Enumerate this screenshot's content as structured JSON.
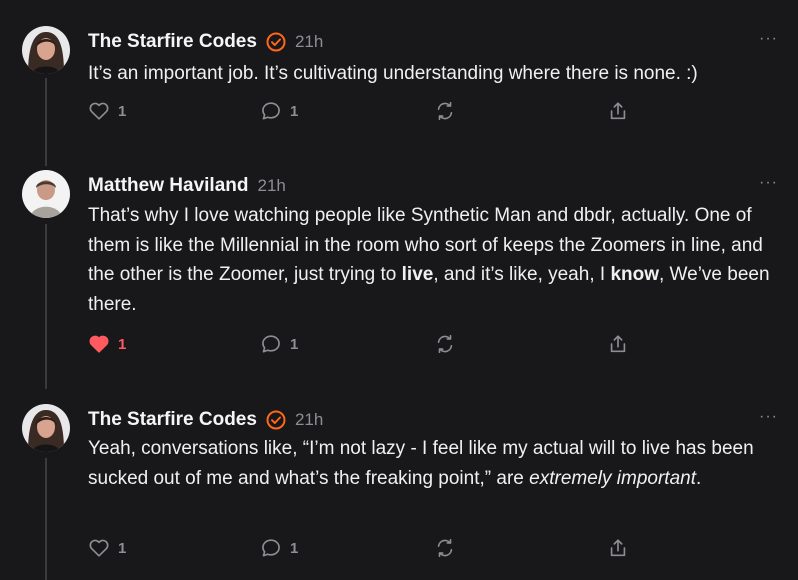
{
  "posts": [
    {
      "author": "The Starfire Codes",
      "verified": true,
      "time": "21h",
      "more_label": "···",
      "text": [
        {
          "t": "It’s an important job. It’s cultivating understanding where there is none. :)",
          "s": "plain"
        }
      ],
      "likes": "1",
      "liked": false,
      "comments": "1"
    },
    {
      "author": "Matthew Haviland",
      "verified": false,
      "time": "21h",
      "more_label": "···",
      "text": [
        {
          "t": "That’s why I love watching people like Synthetic Man and dbdr, actually. One of them is like the Millennial in the room who sort of keeps the Zoomers in line, and the other is the Zoomer, just trying to ",
          "s": "plain"
        },
        {
          "t": "live",
          "s": "bold"
        },
        {
          "t": ", and it’s like, yeah, I ",
          "s": "plain"
        },
        {
          "t": "know",
          "s": "bold"
        },
        {
          "t": ", We’ve been there.",
          "s": "plain"
        }
      ],
      "likes": "1",
      "liked": true,
      "comments": "1"
    },
    {
      "author": "The Starfire Codes",
      "verified": true,
      "time": "21h",
      "more_label": "···",
      "text": [
        {
          "t": "Yeah, conversations like, “I’m not lazy - I feel like my actual will to live has been sucked out of me and what’s the freaking point,” are ",
          "s": "plain"
        },
        {
          "t": "extremely important",
          "s": "italic"
        },
        {
          "t": ".",
          "s": "plain"
        }
      ],
      "likes": "1",
      "liked": false,
      "comments": "1"
    }
  ],
  "colors": {
    "background": "#18181a",
    "verified_badge": "#ff6719",
    "liked_heart": "#ff5a5f",
    "muted": "#8d8d92"
  },
  "icons": [
    "heart-icon",
    "comment-icon",
    "restack-icon",
    "share-icon",
    "verified-icon",
    "more-icon"
  ]
}
